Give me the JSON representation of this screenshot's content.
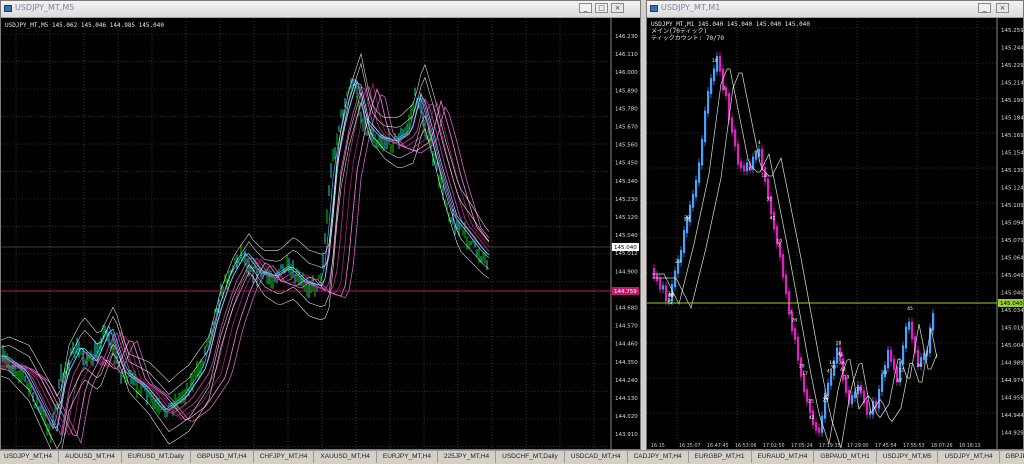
{
  "left_window": {
    "title": "USDJPY_MT,M5",
    "info": "USDJPY_MT,M5  145.062 145.046 144.985 145.040",
    "price_axis": [
      "146.230",
      "146.110",
      "146.000",
      "145.890",
      "145.780",
      "145.670",
      "145.560",
      "145.450",
      "145.340",
      "145.230",
      "145.120",
      "145.040",
      "145.012",
      "144.900",
      "144.790",
      "144.680",
      "144.570",
      "144.460",
      "144.350",
      "144.240",
      "144.130",
      "144.020",
      "143.910",
      "143.800"
    ],
    "current_price": "145.040",
    "line_price": "144.759",
    "colors": {
      "grid": "#5a5a5a",
      "line": "#c0196f",
      "price_green": "#00d000",
      "bands": "#ffffff"
    }
  },
  "right_window": {
    "title": "USDJPY_MT,M1",
    "info_lines": [
      "USDJPY_MT,M1  145.040 145.040 145.040 145.040",
      "メイン(70ティック)",
      "ティックカウント: 70/70"
    ],
    "price_axis": [
      "145.259",
      "145.244",
      "145.229",
      "145.214",
      "145.199",
      "145.184",
      "145.169",
      "145.154",
      "145.139",
      "145.124",
      "145.109",
      "145.094",
      "145.079",
      "145.064",
      "145.049",
      "145.040",
      "145.034",
      "145.019",
      "145.004",
      "144.989",
      "144.974",
      "144.959",
      "144.944",
      "144.929"
    ],
    "current_price": "145.040",
    "time_axis": [
      "16:15",
      "16:35:07",
      "16:47:45",
      "16:53:06",
      "17:02:50",
      "17:05:24",
      "17:19:35",
      "17:29:00",
      "17:45:54",
      "17:55:53",
      "18:07:26",
      "18:18:13"
    ],
    "colors": {
      "line": "#9acd32",
      "up": "#4aa0ff",
      "down": "#e020c0"
    }
  },
  "tabs": [
    "USDJPY_MT,H4",
    "AUDUSD_MT,H4",
    "EURUSD_MT,Daily",
    "GBPUSD_MT,H4",
    "CHFJPY_MT,H4",
    "XAUUSD_MT,H4",
    "EURJPY_MT,H4",
    "225JPY_MT,H4",
    "USDCHF_MT,Daily",
    "USDCAD_MT,H4",
    "CADJPY_MT,H4",
    "EURGBP_MT,H1",
    "EURAUD_MT,H4",
    "GBPAUD_MT,H1",
    "USDJPY_MT,M5",
    "USDJPY_MT,H4",
    "GBPJPY_MT,H4",
    "USDJPY_MT,M1"
  ],
  "active_tab": "USDJPY_MT,M1",
  "window_buttons": {
    "minimize": "_",
    "maximize": "□",
    "close": "×"
  }
}
